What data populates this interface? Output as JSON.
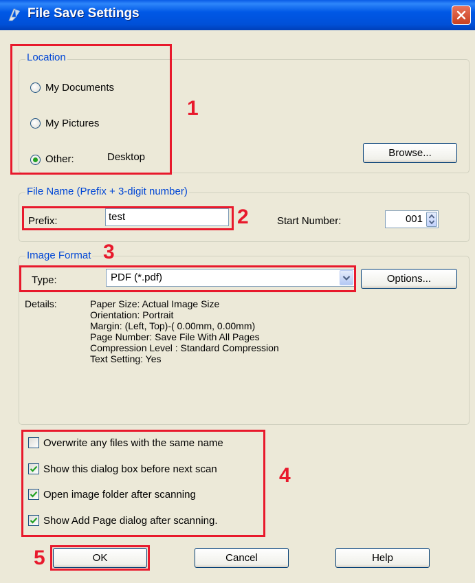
{
  "window": {
    "title": "File Save Settings"
  },
  "location": {
    "legend": "Location",
    "options": [
      {
        "label": "My Documents",
        "selected": false
      },
      {
        "label": "My Pictures",
        "selected": false
      },
      {
        "label": "Other:",
        "selected": true
      }
    ],
    "other_value": "Desktop",
    "browse_label": "Browse..."
  },
  "file_name": {
    "legend": "File Name (Prefix + 3-digit number)",
    "prefix_label": "Prefix:",
    "prefix_value": "test",
    "start_number_label": "Start Number:",
    "start_number_value": "001"
  },
  "image_format": {
    "legend": "Image Format",
    "type_label": "Type:",
    "type_value": "PDF (*.pdf)",
    "options_label": "Options...",
    "details_label": "Details:",
    "details": [
      "Paper Size: Actual Image Size",
      "Orientation: Portrait",
      "Margin: (Left, Top)-( 0.00mm, 0.00mm)",
      "Page Number: Save File With All Pages",
      "Compression Level : Standard Compression",
      "Text Setting: Yes"
    ]
  },
  "checkboxes": [
    {
      "label": "Overwrite any files with the same name",
      "checked": false
    },
    {
      "label": "Show this dialog box before next scan",
      "checked": true
    },
    {
      "label": "Open image folder after scanning",
      "checked": true
    },
    {
      "label": "Show Add Page dialog after scanning.",
      "checked": true
    }
  ],
  "buttons": {
    "ok": "OK",
    "cancel": "Cancel",
    "help": "Help"
  },
  "annotations": [
    "1",
    "2",
    "3",
    "4",
    "5"
  ],
  "colors": {
    "highlight_red": "#E8192C",
    "legend_blue": "#0046D5",
    "dialog_bg": "#ECE9D8",
    "radio_dot": "#21A121"
  }
}
